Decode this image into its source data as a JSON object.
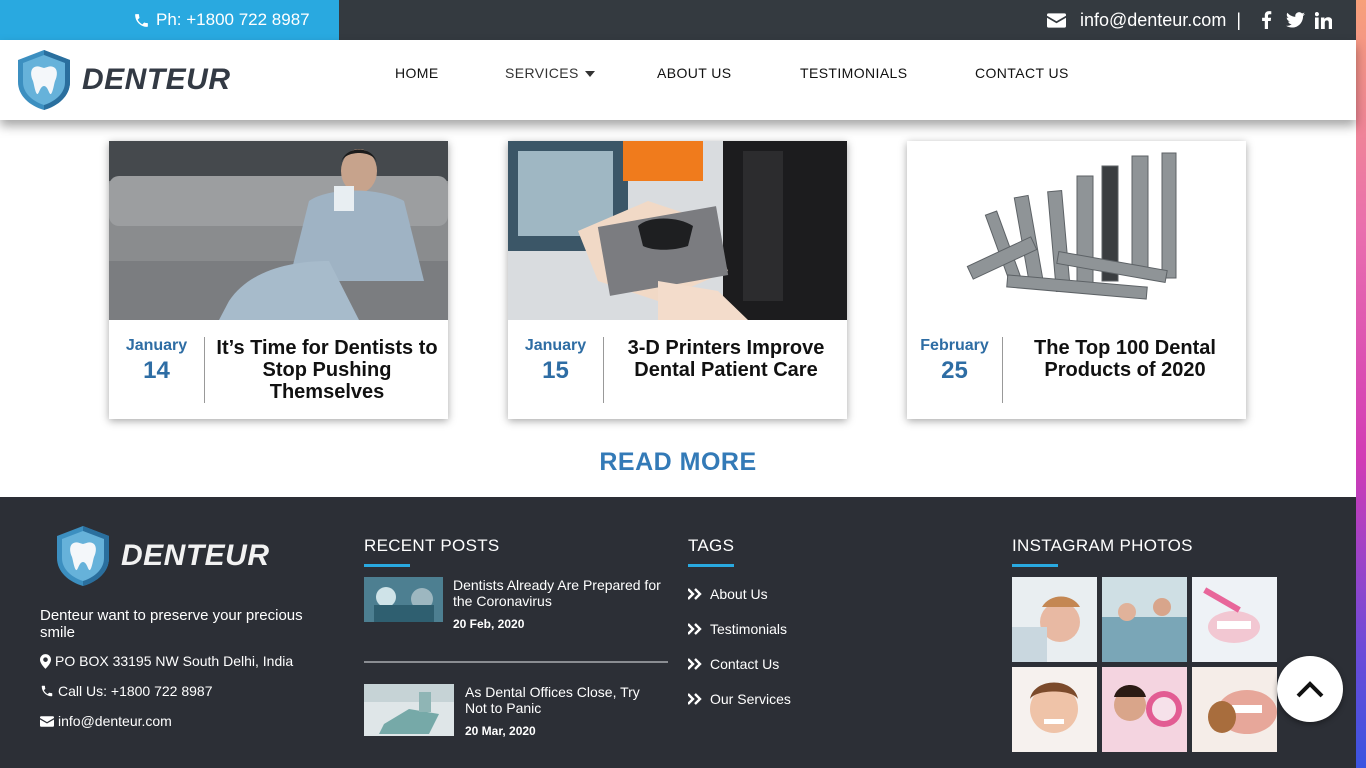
{
  "topbar": {
    "phone": "Ph: +1800 722 8987",
    "email": "info@denteur.com",
    "separator": "|",
    "social_icons": [
      "facebook-icon",
      "twitter-icon",
      "linkedin-icon"
    ]
  },
  "brand": {
    "name": "DENTEUR"
  },
  "nav": {
    "home": "HOME",
    "services": "SERVICES",
    "about": "ABOUT US",
    "testimonials": "TESTIMONIALS",
    "contact": "CONTACT US"
  },
  "cards": [
    {
      "month": "January",
      "day": "14",
      "title": "It’s Time for Dentists to Stop Pushing Themselves"
    },
    {
      "month": "January",
      "day": "15",
      "title": "3-D Printers Improve Dental Patient Care"
    },
    {
      "month": "February",
      "day": "25",
      "title": "The Top 100 Dental Products of 2020"
    }
  ],
  "read_more": "READ MORE",
  "footer": {
    "brand": "DENTEUR",
    "description": "Denteur want to preserve your precious smile",
    "address": "PO BOX 33195 NW South Delhi, India",
    "call": "Call Us: +1800 722 8987",
    "email": "info@denteur.com",
    "recent_posts_title": "RECENT POSTS",
    "posts": [
      {
        "title": "Dentists Already Are Prepared for the Coronavirus",
        "date": "20 Feb, 2020"
      },
      {
        "title": "As Dental Offices Close, Try Not to Panic",
        "date": "20 Mar, 2020"
      }
    ],
    "tags_title": "TAGS",
    "tags": [
      "About Us",
      "Testimonials",
      "Contact Us",
      "Our Services"
    ],
    "instagram_title": "INSTAGRAM PHOTOS"
  },
  "colors": {
    "accent": "#29a9e0",
    "dark": "#343a40",
    "footer_bg": "#2c2f36",
    "link_blue": "#337ab7",
    "date_blue": "#2e6da4"
  }
}
